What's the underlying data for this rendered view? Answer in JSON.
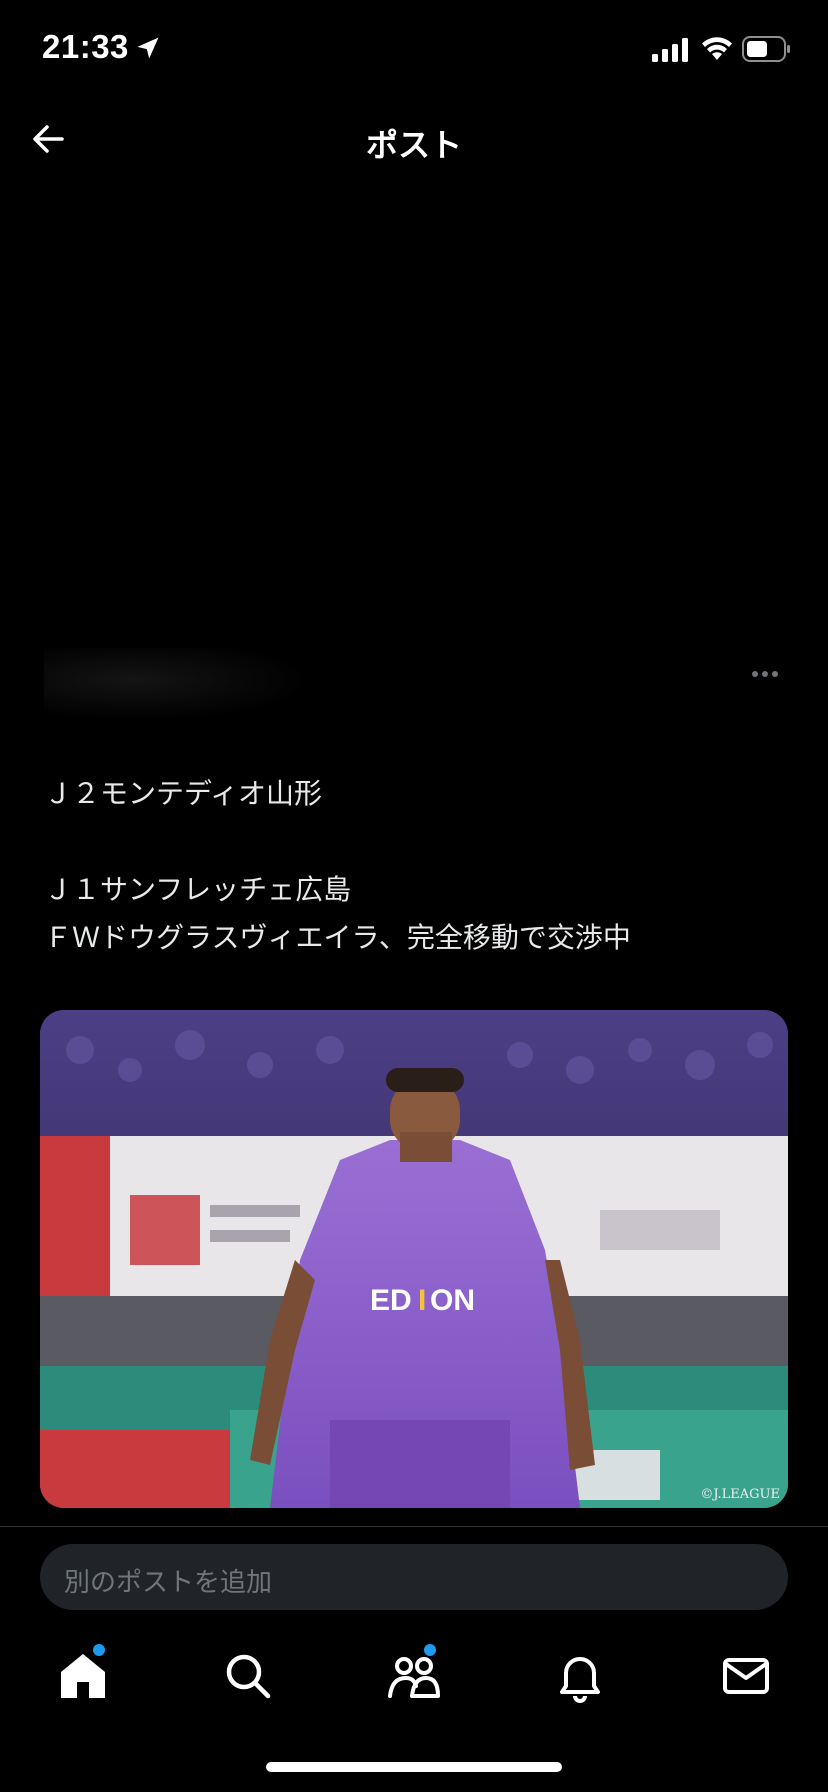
{
  "status_bar": {
    "time": "21:33",
    "icons": [
      "location-arrow-icon",
      "cellular-signal-icon",
      "wifi-icon",
      "battery-icon"
    ]
  },
  "header": {
    "title": "ポスト",
    "back_icon": "back-arrow-icon"
  },
  "post": {
    "more_icon": "more-options-icon",
    "text_lines": [
      "Ｊ２モンテディオ山形",
      "",
      "Ｊ１サンフレッチェ広島",
      "ＦＷドウグラスヴィエイラ、完全移動で交渉中"
    ],
    "media": {
      "watermark": "©J.LEAGUE",
      "description_icon": "photo-soccer-player"
    }
  },
  "reply": {
    "placeholder": "別のポストを追加"
  },
  "bottom_nav": {
    "items": [
      {
        "icon": "home-icon",
        "notification_dot": true
      },
      {
        "icon": "search-icon",
        "notification_dot": false
      },
      {
        "icon": "communities-icon",
        "notification_dot": true
      },
      {
        "icon": "bell-icon",
        "notification_dot": false
      },
      {
        "icon": "mail-icon",
        "notification_dot": false
      }
    ]
  },
  "colors": {
    "background": "#000000",
    "text": "#e7e9ea",
    "muted": "#71767b",
    "accent": "#1d9bf0",
    "input_bg": "#202327"
  }
}
